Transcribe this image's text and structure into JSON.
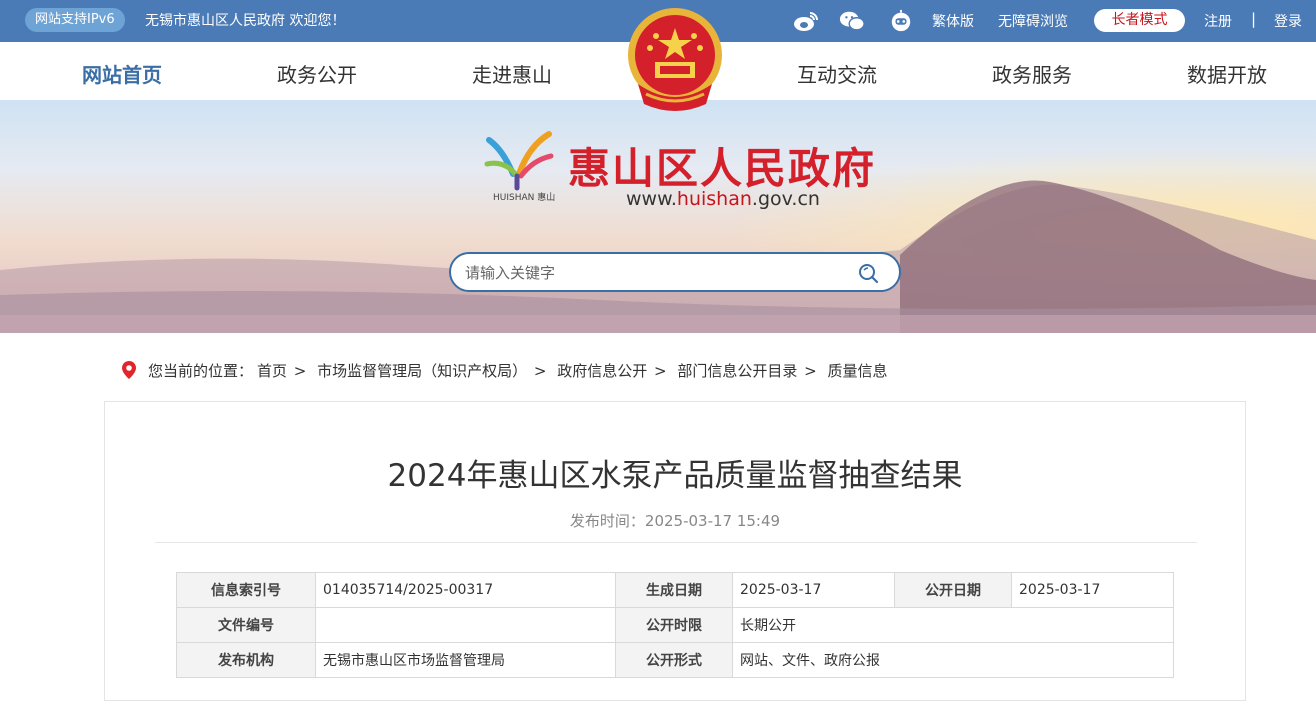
{
  "topbar": {
    "ipv6_badge": "网站支持IPv6",
    "welcome": "无锡市惠山区人民政府 欢迎您！",
    "icons": [
      "weibo-icon",
      "wechat-icon",
      "robot-icon"
    ],
    "links": {
      "traditional": "繁体版",
      "accessible": "无障碍浏览",
      "elder_mode": "长者模式",
      "register": "注册",
      "separator": "|",
      "login": "登录"
    }
  },
  "nav": {
    "items": [
      "网站首页",
      "政务公开",
      "走进惠山",
      "互动交流",
      "政务服务",
      "数据开放"
    ]
  },
  "banner": {
    "logo_text": "HUISHAN 惠山",
    "site_title": "惠山区人民政府",
    "url_prefix": "www.",
    "url_highlight": "huishan",
    "url_suffix": ".gov.cn",
    "search_placeholder": "请输入关键字"
  },
  "breadcrumb": {
    "label": "您当前的位置：",
    "items": [
      "首页",
      "市场监督管理局（知识产权局）",
      "政府信息公开",
      "部门信息公开目录",
      "质量信息"
    ]
  },
  "article": {
    "title": "2024年惠山区水泵产品质量监督抽查结果",
    "pub_time": "发布时间：2025-03-17 15:49"
  },
  "meta_table": {
    "rows": [
      [
        "信息索引号",
        "014035714/2025-00317",
        "生成日期",
        "2025-03-17",
        "公开日期",
        "2025-03-17"
      ],
      [
        "文件编号",
        "",
        "公开时限",
        "长期公开"
      ],
      [
        "发布机构",
        "无锡市惠山区市场监督管理局",
        "公开形式",
        "网站、文件、政府公报"
      ]
    ]
  },
  "colors": {
    "topbar": "#4a7bb7",
    "accent_red": "#d3202a",
    "nav_active": "#3a6ea5"
  }
}
